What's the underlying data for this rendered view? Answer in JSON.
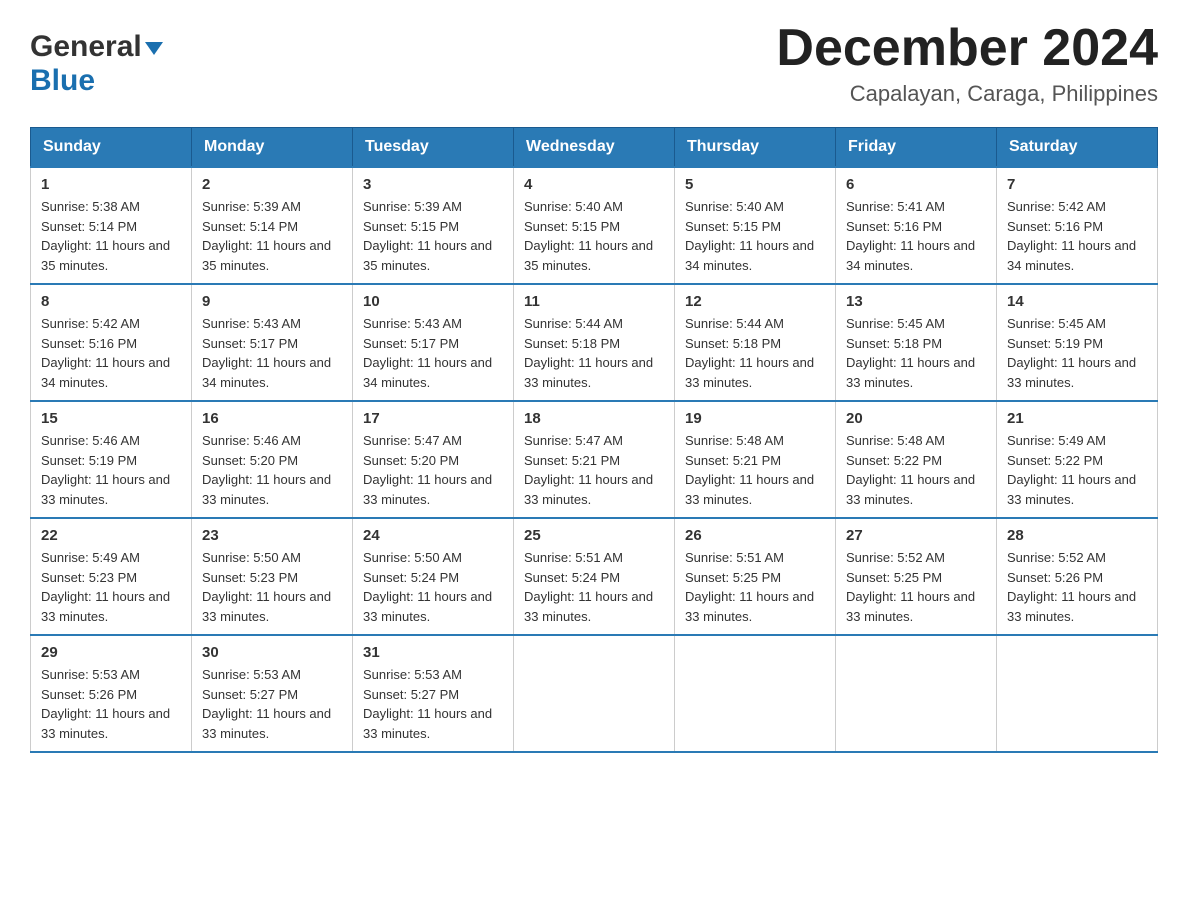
{
  "logo": {
    "general": "General",
    "blue": "Blue"
  },
  "title": "December 2024",
  "location": "Capalayan, Caraga, Philippines",
  "days_of_week": [
    "Sunday",
    "Monday",
    "Tuesday",
    "Wednesday",
    "Thursday",
    "Friday",
    "Saturday"
  ],
  "weeks": [
    [
      {
        "day": "1",
        "sunrise": "5:38 AM",
        "sunset": "5:14 PM",
        "daylight": "11 hours and 35 minutes."
      },
      {
        "day": "2",
        "sunrise": "5:39 AM",
        "sunset": "5:14 PM",
        "daylight": "11 hours and 35 minutes."
      },
      {
        "day": "3",
        "sunrise": "5:39 AM",
        "sunset": "5:15 PM",
        "daylight": "11 hours and 35 minutes."
      },
      {
        "day": "4",
        "sunrise": "5:40 AM",
        "sunset": "5:15 PM",
        "daylight": "11 hours and 35 minutes."
      },
      {
        "day": "5",
        "sunrise": "5:40 AM",
        "sunset": "5:15 PM",
        "daylight": "11 hours and 34 minutes."
      },
      {
        "day": "6",
        "sunrise": "5:41 AM",
        "sunset": "5:16 PM",
        "daylight": "11 hours and 34 minutes."
      },
      {
        "day": "7",
        "sunrise": "5:42 AM",
        "sunset": "5:16 PM",
        "daylight": "11 hours and 34 minutes."
      }
    ],
    [
      {
        "day": "8",
        "sunrise": "5:42 AM",
        "sunset": "5:16 PM",
        "daylight": "11 hours and 34 minutes."
      },
      {
        "day": "9",
        "sunrise": "5:43 AM",
        "sunset": "5:17 PM",
        "daylight": "11 hours and 34 minutes."
      },
      {
        "day": "10",
        "sunrise": "5:43 AM",
        "sunset": "5:17 PM",
        "daylight": "11 hours and 34 minutes."
      },
      {
        "day": "11",
        "sunrise": "5:44 AM",
        "sunset": "5:18 PM",
        "daylight": "11 hours and 33 minutes."
      },
      {
        "day": "12",
        "sunrise": "5:44 AM",
        "sunset": "5:18 PM",
        "daylight": "11 hours and 33 minutes."
      },
      {
        "day": "13",
        "sunrise": "5:45 AM",
        "sunset": "5:18 PM",
        "daylight": "11 hours and 33 minutes."
      },
      {
        "day": "14",
        "sunrise": "5:45 AM",
        "sunset": "5:19 PM",
        "daylight": "11 hours and 33 minutes."
      }
    ],
    [
      {
        "day": "15",
        "sunrise": "5:46 AM",
        "sunset": "5:19 PM",
        "daylight": "11 hours and 33 minutes."
      },
      {
        "day": "16",
        "sunrise": "5:46 AM",
        "sunset": "5:20 PM",
        "daylight": "11 hours and 33 minutes."
      },
      {
        "day": "17",
        "sunrise": "5:47 AM",
        "sunset": "5:20 PM",
        "daylight": "11 hours and 33 minutes."
      },
      {
        "day": "18",
        "sunrise": "5:47 AM",
        "sunset": "5:21 PM",
        "daylight": "11 hours and 33 minutes."
      },
      {
        "day": "19",
        "sunrise": "5:48 AM",
        "sunset": "5:21 PM",
        "daylight": "11 hours and 33 minutes."
      },
      {
        "day": "20",
        "sunrise": "5:48 AM",
        "sunset": "5:22 PM",
        "daylight": "11 hours and 33 minutes."
      },
      {
        "day": "21",
        "sunrise": "5:49 AM",
        "sunset": "5:22 PM",
        "daylight": "11 hours and 33 minutes."
      }
    ],
    [
      {
        "day": "22",
        "sunrise": "5:49 AM",
        "sunset": "5:23 PM",
        "daylight": "11 hours and 33 minutes."
      },
      {
        "day": "23",
        "sunrise": "5:50 AM",
        "sunset": "5:23 PM",
        "daylight": "11 hours and 33 minutes."
      },
      {
        "day": "24",
        "sunrise": "5:50 AM",
        "sunset": "5:24 PM",
        "daylight": "11 hours and 33 minutes."
      },
      {
        "day": "25",
        "sunrise": "5:51 AM",
        "sunset": "5:24 PM",
        "daylight": "11 hours and 33 minutes."
      },
      {
        "day": "26",
        "sunrise": "5:51 AM",
        "sunset": "5:25 PM",
        "daylight": "11 hours and 33 minutes."
      },
      {
        "day": "27",
        "sunrise": "5:52 AM",
        "sunset": "5:25 PM",
        "daylight": "11 hours and 33 minutes."
      },
      {
        "day": "28",
        "sunrise": "5:52 AM",
        "sunset": "5:26 PM",
        "daylight": "11 hours and 33 minutes."
      }
    ],
    [
      {
        "day": "29",
        "sunrise": "5:53 AM",
        "sunset": "5:26 PM",
        "daylight": "11 hours and 33 minutes."
      },
      {
        "day": "30",
        "sunrise": "5:53 AM",
        "sunset": "5:27 PM",
        "daylight": "11 hours and 33 minutes."
      },
      {
        "day": "31",
        "sunrise": "5:53 AM",
        "sunset": "5:27 PM",
        "daylight": "11 hours and 33 minutes."
      },
      null,
      null,
      null,
      null
    ]
  ],
  "labels": {
    "sunrise": "Sunrise:",
    "sunset": "Sunset:",
    "daylight": "Daylight:"
  }
}
